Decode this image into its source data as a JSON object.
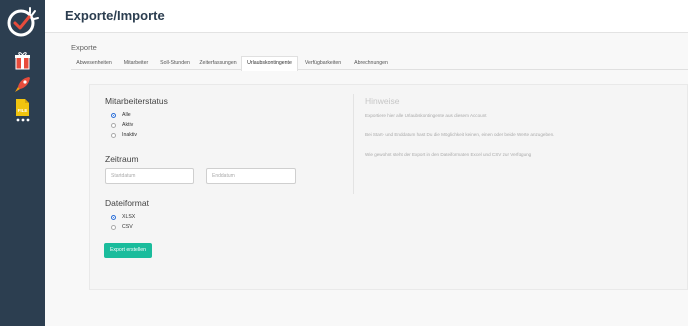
{
  "header": {
    "title": "Exporte/Importe"
  },
  "sidebar": {
    "icons": [
      "stopwatch-check-logo",
      "gift-icon",
      "rocket-icon",
      "file-icon",
      "more-dots-icon"
    ],
    "file_icon_text": "FILE",
    "colors": {
      "background": "#2c3e50",
      "logo_check": "#e74c3c",
      "gift": "#e74c3c",
      "file": "#f1c40f"
    }
  },
  "section": {
    "label": "Exporte"
  },
  "tabs": [
    {
      "label": "Abwesenheiten",
      "active": false
    },
    {
      "label": "Mitarbeiter",
      "active": false
    },
    {
      "label": "Soll-Stunden",
      "active": false
    },
    {
      "label": "Zeiterfassungen",
      "active": false
    },
    {
      "label": "Urlaubskontingente",
      "active": true
    },
    {
      "label": "Verfügbarkeiten",
      "active": false
    },
    {
      "label": "Abrechnungen",
      "active": false
    }
  ],
  "form": {
    "status": {
      "heading": "Mitarbeiterstatus",
      "options": [
        {
          "label": "Alle",
          "checked": true
        },
        {
          "label": "Aktiv",
          "checked": false
        },
        {
          "label": "Inaktiv",
          "checked": false
        }
      ]
    },
    "period": {
      "heading": "Zeitraum",
      "start_placeholder": "Startdatum",
      "end_placeholder": "Enddatum"
    },
    "format": {
      "heading": "Dateiformat",
      "options": [
        {
          "label": "XLSX",
          "checked": true
        },
        {
          "label": "CSV",
          "checked": false
        }
      ]
    },
    "submit_label": "Export erstellen"
  },
  "hints": {
    "title": "Hinweise",
    "lines": [
      "Exportiere hier alle Urlaubskontingente aus diesem Account",
      "Bei Start- und Enddatum hast Du die Möglichkeit keinen, einen oder beide Werte anzugeben.",
      "Wie gewohnt steht der Export in den Dateiformaten Excel und CSV zur Verfügung"
    ]
  },
  "colors": {
    "accent": "#1abc9c",
    "radio_checked": "#2d6fd6",
    "title": "#2c3e50"
  }
}
